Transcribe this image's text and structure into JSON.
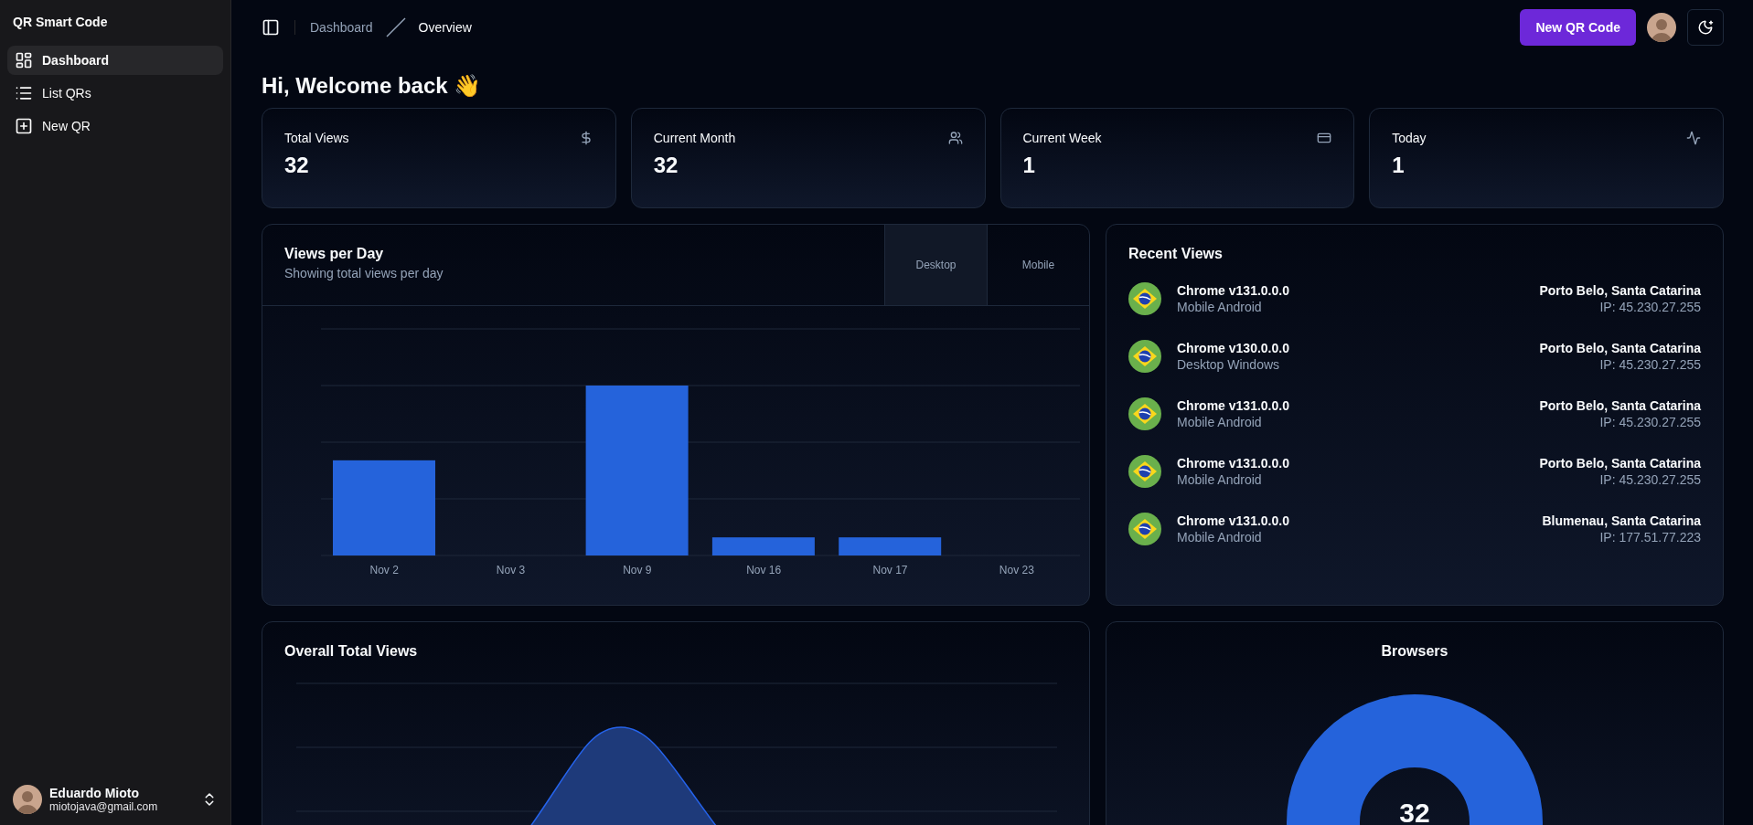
{
  "sidebar": {
    "app_title": "QR Smart Code",
    "items": [
      {
        "label": "Dashboard",
        "selected": true
      },
      {
        "label": "List QRs",
        "selected": false
      },
      {
        "label": "New QR",
        "selected": false
      }
    ],
    "user": {
      "name": "Eduardo Mioto",
      "email": "miotojava@gmail.com"
    }
  },
  "header": {
    "breadcrumb": [
      "Dashboard",
      "Overview"
    ],
    "new_button": "New QR Code"
  },
  "greeting": "Hi, Welcome back 👋",
  "stats": [
    {
      "label": "Total Views",
      "value": "32"
    },
    {
      "label": "Current Month",
      "value": "32"
    },
    {
      "label": "Current Week",
      "value": "1"
    },
    {
      "label": "Today",
      "value": "1"
    }
  ],
  "views_per_day": {
    "title": "Views per Day",
    "subtitle": "Showing total views per day",
    "tabs": [
      {
        "label": "Desktop",
        "selected": true
      },
      {
        "label": "Mobile",
        "selected": false
      }
    ],
    "day_labels": [
      "Nov 2",
      "Nov 3",
      "Nov 9",
      "Nov 16",
      "Nov 17",
      "Nov 23"
    ]
  },
  "recent_views": {
    "title": "Recent Views",
    "items": [
      {
        "browser": "Chrome v131.0.0.0",
        "device": "Mobile Android",
        "location": "Porto Belo, Santa Catarina",
        "ip": "IP: 45.230.27.255"
      },
      {
        "browser": "Chrome v130.0.0.0",
        "device": "Desktop Windows",
        "location": "Porto Belo, Santa Catarina",
        "ip": "IP: 45.230.27.255"
      },
      {
        "browser": "Chrome v131.0.0.0",
        "device": "Mobile Android",
        "location": "Porto Belo, Santa Catarina",
        "ip": "IP: 45.230.27.255"
      },
      {
        "browser": "Chrome v131.0.0.0",
        "device": "Mobile Android",
        "location": "Porto Belo, Santa Catarina",
        "ip": "IP: 45.230.27.255"
      },
      {
        "browser": "Chrome v131.0.0.0",
        "device": "Mobile Android",
        "location": "Blumenau, Santa Catarina",
        "ip": "IP: 177.51.77.223"
      }
    ]
  },
  "overall": {
    "title": "Overall Total Views"
  },
  "browsers": {
    "title": "Browsers",
    "total": "32"
  }
}
